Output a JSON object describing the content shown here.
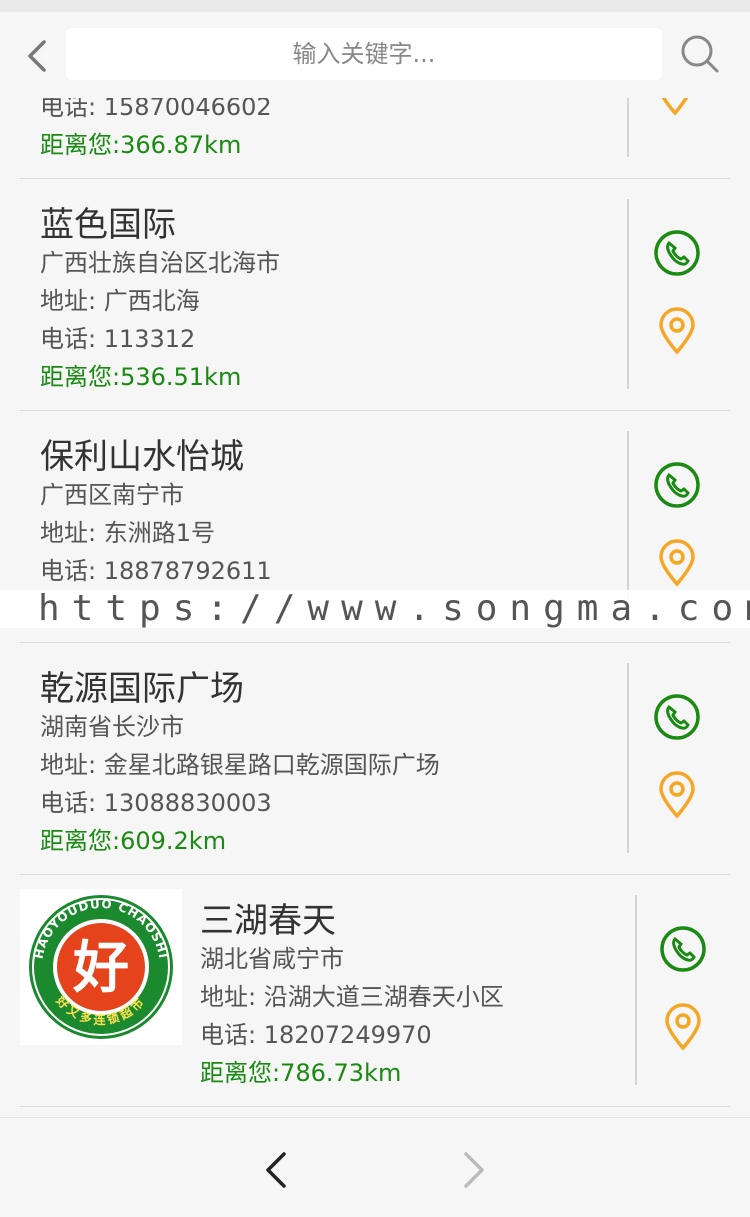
{
  "search": {
    "placeholder": "输入关键字..."
  },
  "partial_item": {
    "phone": "电话: 15870046602",
    "distance": "距离您:366.87km"
  },
  "stores": [
    {
      "name": "蓝色国际",
      "region": "广西壮族自治区北海市",
      "address": "地址: 广西北海",
      "phone": "电话: 113312",
      "distance": "距离您:536.51km"
    },
    {
      "name": "保利山水怡城",
      "region": "广西区南宁市",
      "address": "地址: 东洲路1号",
      "phone": "电话: 18878792611",
      "distance": ""
    },
    {
      "name": "乾源国际广场",
      "region": "湖南省长沙市",
      "address": "地址: 金星北路银星路口乾源国际广场",
      "phone": "电话: 13088830003",
      "distance": "距离您:609.2km"
    },
    {
      "name": "三湖春天",
      "region": "湖北省咸宁市",
      "address": "地址: 沿湖大道三湖春天小区",
      "phone": "电话: 18207249970",
      "distance": "距离您:786.73km"
    }
  ],
  "logo": {
    "arc_text": "HAOYOUDUO CHAOSHI",
    "bottom_text": "好又多连锁超市",
    "glyph": "好"
  },
  "watermark": "https://www.songma.com",
  "colors": {
    "accent_green": "#1a8a12",
    "location_orange": "#f5a623"
  }
}
